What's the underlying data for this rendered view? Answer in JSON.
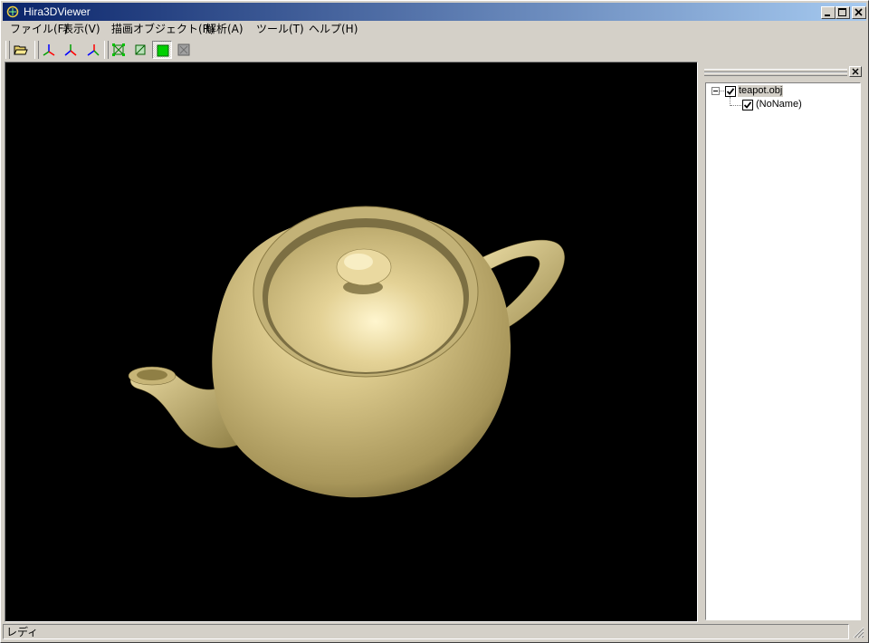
{
  "window": {
    "title": "Hira3DViewer"
  },
  "menu": [
    {
      "label": "ファイル(F)"
    },
    {
      "label": "表示(V)"
    },
    {
      "label": "描画オブジェクト(R)"
    },
    {
      "label": "解析(A)"
    },
    {
      "label": "ツール(T)"
    },
    {
      "label": "ヘルプ(H)"
    }
  ],
  "toolbar": {
    "buttons": [
      "open-folder-icon",
      "axis-xy-icon",
      "axis-yz-icon",
      "axis-zx-icon",
      "wireframe-icon",
      "edges-icon",
      "solid-shading-icon",
      "textured-icon"
    ],
    "pressed": "solid-shading-icon"
  },
  "viewport": {
    "background": "#000000",
    "model_color": "#c9b77a"
  },
  "tree": {
    "root": {
      "label": "teapot.obj",
      "checked": true,
      "expanded": true
    },
    "children": [
      {
        "label": "(NoName)",
        "checked": true
      }
    ]
  },
  "status": {
    "text": "レディ"
  }
}
